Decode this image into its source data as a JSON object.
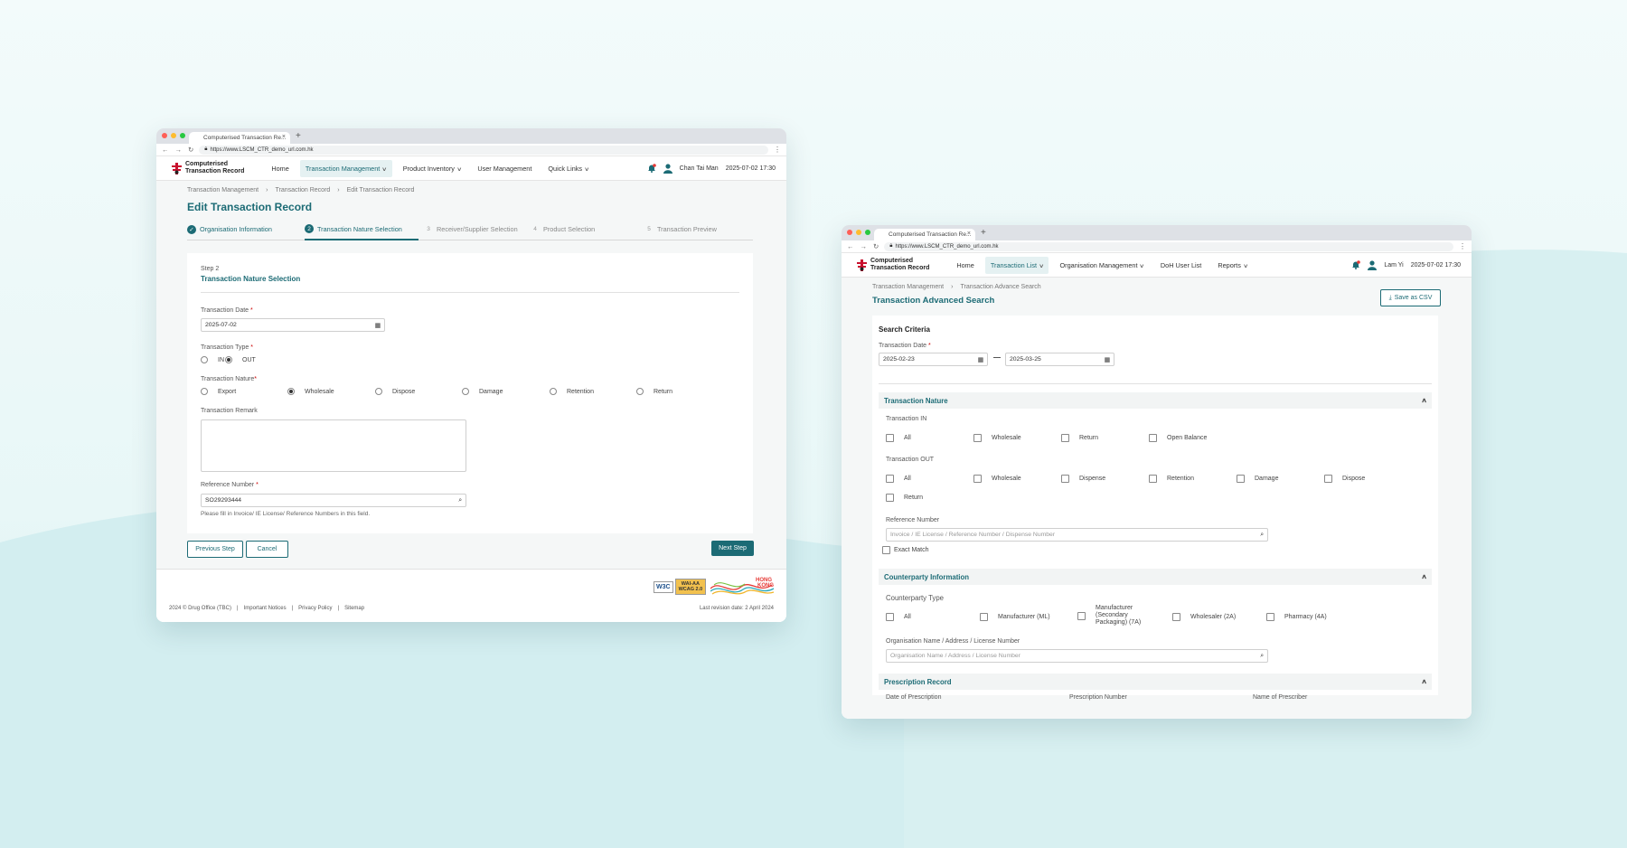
{
  "browser": {
    "tab_title": "Computerised Transaction Re...",
    "url": "https://www.LSCM_CTR_demo_url.com.hk"
  },
  "app": {
    "logo_line1": "Computerised",
    "logo_line2": "Transaction Record",
    "accent": "#1c6b75"
  },
  "left": {
    "nav": [
      "Home",
      "Transaction Management",
      "Product Inventory",
      "User Management",
      "Quick Links"
    ],
    "user": "Chan Tai Man",
    "datetime": "2025-07-02 17:30",
    "breadcrumb": [
      "Transaction Management",
      "Transaction Record",
      "Edit Transaction Record"
    ],
    "title": "Edit Transaction Record",
    "steps": [
      {
        "num": "✓",
        "label": "Organisation Information"
      },
      {
        "num": "2",
        "label": "Transaction Nature Selection"
      },
      {
        "num": "3",
        "label": "Receiver/Supplier Selection"
      },
      {
        "num": "4",
        "label": "Product Selection"
      },
      {
        "num": "5",
        "label": "Transaction Preview"
      }
    ],
    "step_label": "Step 2",
    "step_title": "Transaction Nature Selection",
    "date_label": "Transaction Date",
    "date_value": "2025-07-02",
    "type_label": "Transaction Type",
    "type_in": "IN",
    "type_out": "OUT",
    "nature_label": "Transaction Nature",
    "natures": [
      "Export",
      "Wholesale",
      "Dispose",
      "Damage",
      "Retention",
      "Return"
    ],
    "remark_label": "Transaction Remark",
    "ref_label": "Reference Number",
    "ref_value": "SO29293444",
    "ref_hint": "Please fill in Invoice/ IE License/ Reference Numbers in this field.",
    "btn_prev": "Previous Step",
    "btn_cancel": "Cancel",
    "btn_next": "Next Step",
    "footer_links": [
      "2024 © Drug Office (TBC)",
      "Important Notices",
      "Privacy Policy",
      "Sitemap"
    ],
    "footer_revision": "Last revision date: 2 April 2024",
    "badge_w3c": "W3C",
    "badge_wai1": "WAI-AA",
    "badge_wai2": "WCAG 2.0",
    "badge_hk1": "HONG",
    "badge_hk2": "KONG"
  },
  "right": {
    "nav": [
      "Home",
      "Transaction List",
      "Organisation Management",
      "DoH User List",
      "Reports"
    ],
    "user": "Lam Yi",
    "datetime": "2025-07-02 17:30",
    "breadcrumb": [
      "Transaction Management",
      "Transaction Advance Search"
    ],
    "title": "Transaction Advanced Search",
    "csv_button": "Save as CSV",
    "criteria": "Search Criteria",
    "date_label": "Transaction Date",
    "date_from": "2025-02-23",
    "date_to": "2025-03-25",
    "nature_section": "Transaction Nature",
    "in_label": "Transaction IN",
    "in_opts": [
      "All",
      "Wholesale",
      "Return",
      "Open Balance"
    ],
    "out_label": "Transaction OUT",
    "out_opts": [
      "All",
      "Wholesale",
      "Dispense",
      "Retention",
      "Damage",
      "Dispose",
      "Return"
    ],
    "ref_label": "Reference Number",
    "ref_placeholder": "Invoice / IE License / Reference Number / Dispense Number",
    "exact": "Exact Match",
    "counterparty_section": "Counterparty Information",
    "cp_type": "Counterparty Type",
    "cp_opts": [
      "All",
      "Manufacturer (ML)",
      "Manufacturer (Secondary Packaging) (7A)",
      "Wholesaler (2A)",
      "Pharmacy (4A)"
    ],
    "org_label": "Organisation Name / Address / License Number",
    "org_placeholder": "Organisation Name / Address / License Number",
    "prescription_section": "Prescription Record",
    "presc_cols": [
      "Date of Prescription",
      "Prescription Number",
      "Name of Prescriber"
    ]
  }
}
